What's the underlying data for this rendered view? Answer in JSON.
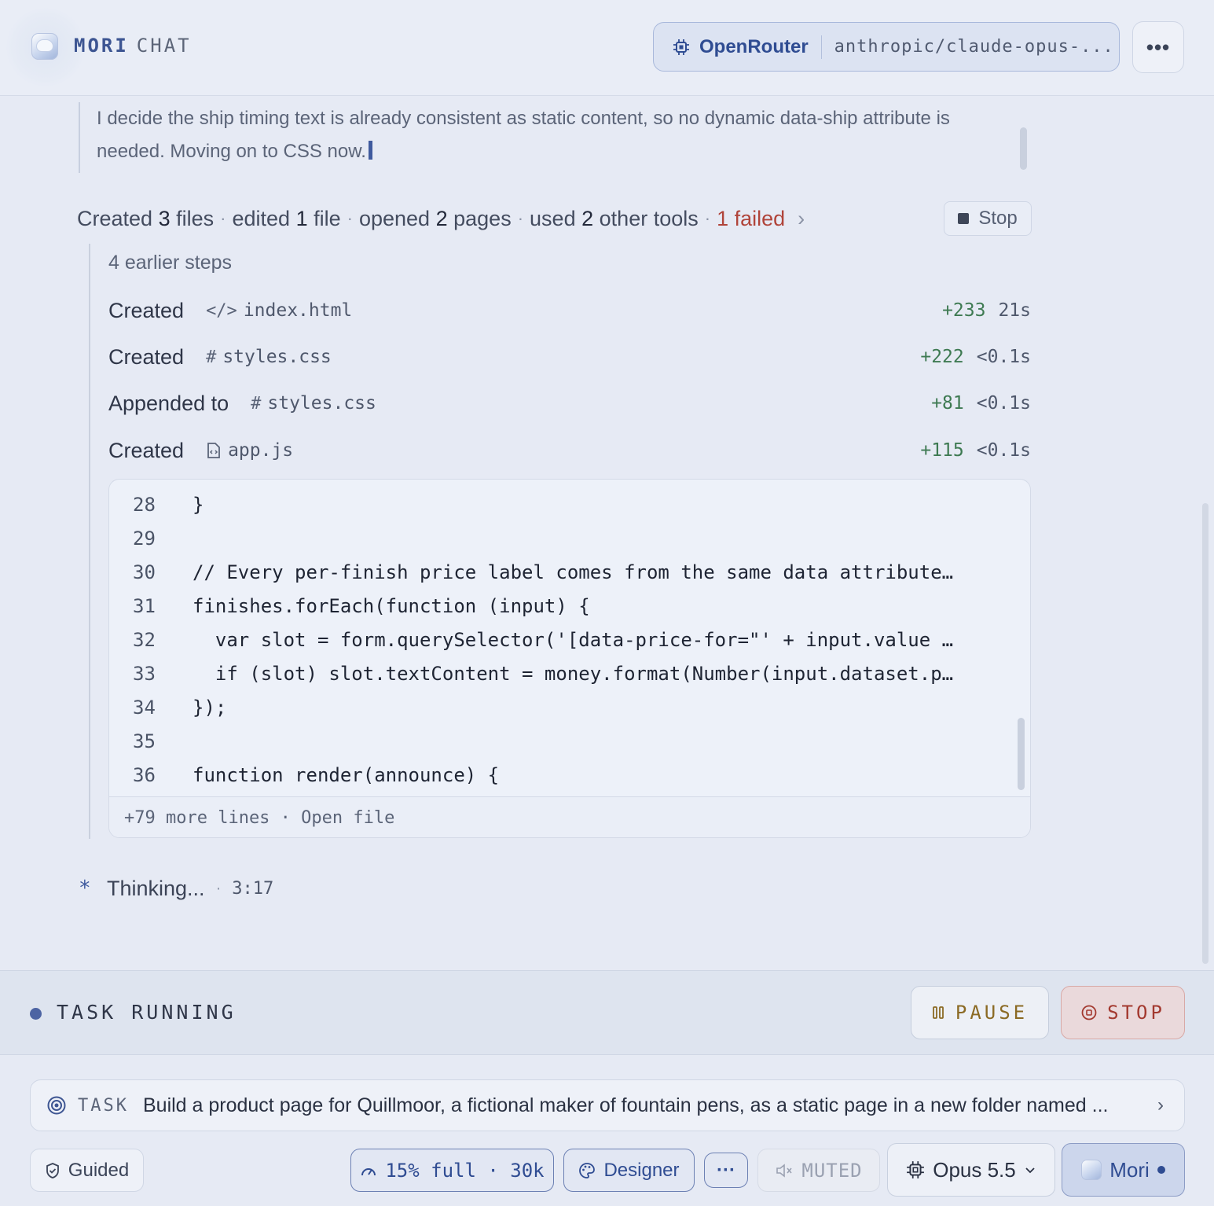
{
  "header": {
    "brand_primary": "MORI",
    "brand_secondary": "CHAT",
    "provider": "OpenRouter",
    "model": "anthropic/claude-opus-...",
    "menu_label": "•••"
  },
  "thought": {
    "text": "I decide the ship timing text is already consistent as static content, so no dynamic data-ship attribute is needed. Moving on to CSS now."
  },
  "summary": {
    "created_count": "3",
    "created_word": "files",
    "edited_count": "1",
    "edited_word": "file",
    "opened_count": "2",
    "opened_word": "pages",
    "used_count": "2",
    "used_word": "other tools",
    "failed": "1 failed",
    "stop_label": "Stop",
    "w_created": "Created",
    "w_edited": "edited",
    "w_opened": "opened",
    "w_used": "used"
  },
  "steps": {
    "earlier": "4 earlier steps",
    "items": [
      {
        "verb": "Created",
        "icon": "</>",
        "file": "index.html",
        "added": "+233",
        "duration": "21s"
      },
      {
        "verb": "Created",
        "icon": "#",
        "file": "styles.css",
        "added": "+222",
        "duration": "<0.1s"
      },
      {
        "verb": "Appended to",
        "icon": "#",
        "file": "styles.css",
        "added": "+81",
        "duration": "<0.1s"
      },
      {
        "verb": "Created",
        "icon": "▢",
        "file": "app.js",
        "added": "+115",
        "duration": "<0.1s"
      }
    ]
  },
  "code": {
    "lines": [
      {
        "n": "28",
        "t": "}"
      },
      {
        "n": "29",
        "t": ""
      },
      {
        "n": "30",
        "t": "// Every per-finish price label comes from the same data attribute…"
      },
      {
        "n": "31",
        "t": "finishes.forEach(function (input) {"
      },
      {
        "n": "32",
        "t": "  var slot = form.querySelector('[data-price-for=\"' + input.value …"
      },
      {
        "n": "33",
        "t": "  if (slot) slot.textContent = money.format(Number(input.dataset.p…"
      },
      {
        "n": "34",
        "t": "});"
      },
      {
        "n": "35",
        "t": ""
      },
      {
        "n": "36",
        "t": "function render(announce) {"
      }
    ],
    "footer": "+79 more lines · Open file"
  },
  "status": {
    "label": "Thinking...",
    "time": "3:17"
  },
  "run_bar": {
    "label": "TASK RUNNING",
    "pause_label": "PAUSE",
    "stop_label": "STOP"
  },
  "task": {
    "label": "TASK",
    "text": "Build a product page for Quillmoor, a fictional maker of fountain pens, as a static page in a new folder named ..."
  },
  "toolbar": {
    "guided": "Guided",
    "context": "15% full · 30k",
    "designer": "Designer",
    "more": "···",
    "muted": "MUTED",
    "model": "Opus 5.5",
    "agent": "Mori"
  },
  "colors": {
    "accent": "#2f4c92",
    "added": "#3e7a52",
    "failed": "#b0443a",
    "pause": "#8b6a24",
    "stop": "#a3392f"
  }
}
